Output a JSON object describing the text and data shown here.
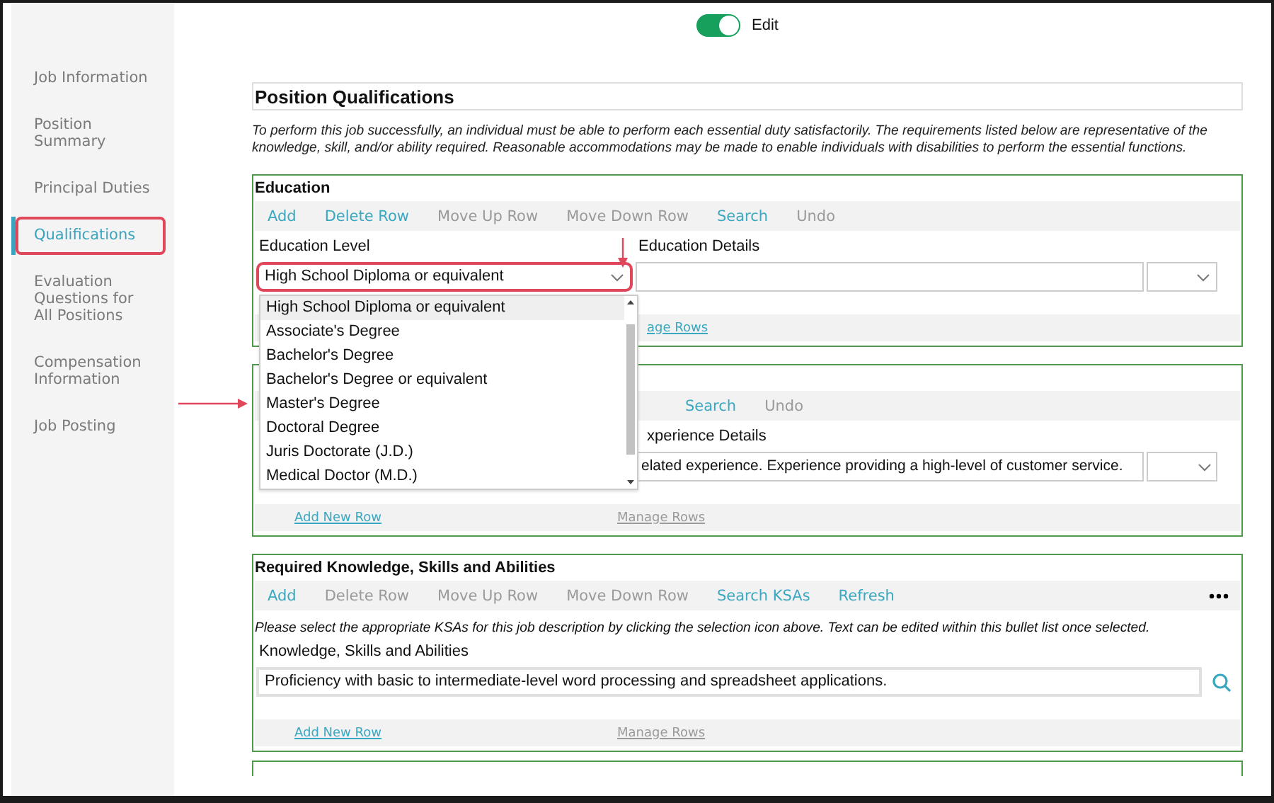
{
  "toggle": {
    "label": "Edit",
    "on": true
  },
  "sidebar": {
    "items": [
      {
        "label": "Job Information",
        "selected": false,
        "highlighted": false
      },
      {
        "label": "Position Summary",
        "selected": false,
        "highlighted": false
      },
      {
        "label": "Principal Duties",
        "selected": false,
        "highlighted": false
      },
      {
        "label": "Qualifications",
        "selected": true,
        "highlighted": true
      },
      {
        "label": "Evaluation Questions for All Positions",
        "selected": false,
        "highlighted": false
      },
      {
        "label": "Compensation Information",
        "selected": false,
        "highlighted": false
      },
      {
        "label": "Job Posting",
        "selected": false,
        "highlighted": false
      }
    ]
  },
  "page_title": "Position Qualifications",
  "intro": "To perform this job successfully, an individual must be able to perform each essential duty satisfactorily. The requirements listed below are representative of the knowledge, skill, and/or ability required. Reasonable accommodations may be made to enable individuals with disabilities to perform the essential functions.",
  "sections": [
    {
      "kind": "education",
      "title": "Education",
      "toolbar": [
        {
          "label": "Add",
          "disabled": false
        },
        {
          "label": "Delete Row",
          "disabled": false
        },
        {
          "label": "Move Up Row",
          "disabled": true
        },
        {
          "label": "Move Down Row",
          "disabled": true
        },
        {
          "label": "Search",
          "disabled": false
        },
        {
          "label": "Undo",
          "disabled": true
        }
      ],
      "fields": [
        {
          "kind": "select",
          "header": "Education Level",
          "value": "High School Diploma or equivalent",
          "highlighted": true
        },
        {
          "kind": "text",
          "header": "Education Details"
        },
        {
          "kind": "select"
        }
      ],
      "footer": {
        "manage": {
          "label": "age Rows",
          "disabled": false
        }
      },
      "dropdown": {
        "options": [
          {
            "label": "High School Diploma or equivalent",
            "selected": true
          },
          {
            "label": "Associate's Degree",
            "selected": false
          },
          {
            "label": "Bachelor's Degree",
            "selected": false
          },
          {
            "label": "Bachelor's Degree or equivalent",
            "selected": false
          },
          {
            "label": "Master's Degree",
            "selected": false
          },
          {
            "label": "Doctoral Degree",
            "selected": false
          },
          {
            "label": "Juris Doctorate (J.D.)",
            "selected": false
          },
          {
            "label": "Medical Doctor (M.D.)",
            "selected": false
          }
        ]
      }
    },
    {
      "kind": "experience",
      "toolbar": [
        {
          "label": "Search",
          "disabled": false
        },
        {
          "label": "Undo",
          "disabled": true
        }
      ],
      "fields": [
        {
          "kind": "blank"
        },
        {
          "kind": "text",
          "header": "xperience Details",
          "value": "elated experience. Experience providing a high-level of customer service."
        },
        {
          "kind": "select"
        }
      ],
      "footer": {
        "add": {
          "label": "Add New Row",
          "disabled": false
        },
        "manage": {
          "label": "Manage Rows",
          "disabled": true
        }
      }
    },
    {
      "kind": "ksa",
      "title": "Required Knowledge, Skills and Abilities",
      "more_menu": true,
      "toolbar": [
        {
          "label": "Add",
          "disabled": false
        },
        {
          "label": "Delete Row",
          "disabled": true
        },
        {
          "label": "Move Up Row",
          "disabled": true
        },
        {
          "label": "Move Down Row",
          "disabled": true
        },
        {
          "label": "Search KSAs",
          "disabled": false
        },
        {
          "label": "Refresh",
          "disabled": false
        }
      ],
      "note": "Please select the appropriate KSAs for this job description by clicking the selection icon above.  Text can be edited within this bullet list once selected.",
      "fields": [
        {
          "kind": "text",
          "header": "Knowledge, Skills and Abilities",
          "value": "Proficiency with basic to intermediate-level word processing and spreadsheet applications."
        },
        {
          "kind": "search"
        }
      ],
      "footer": {
        "add": {
          "label": "Add New Row",
          "disabled": false
        },
        "manage": {
          "label": "Manage Rows",
          "disabled": true
        }
      }
    },
    {
      "kind": "empty"
    }
  ]
}
